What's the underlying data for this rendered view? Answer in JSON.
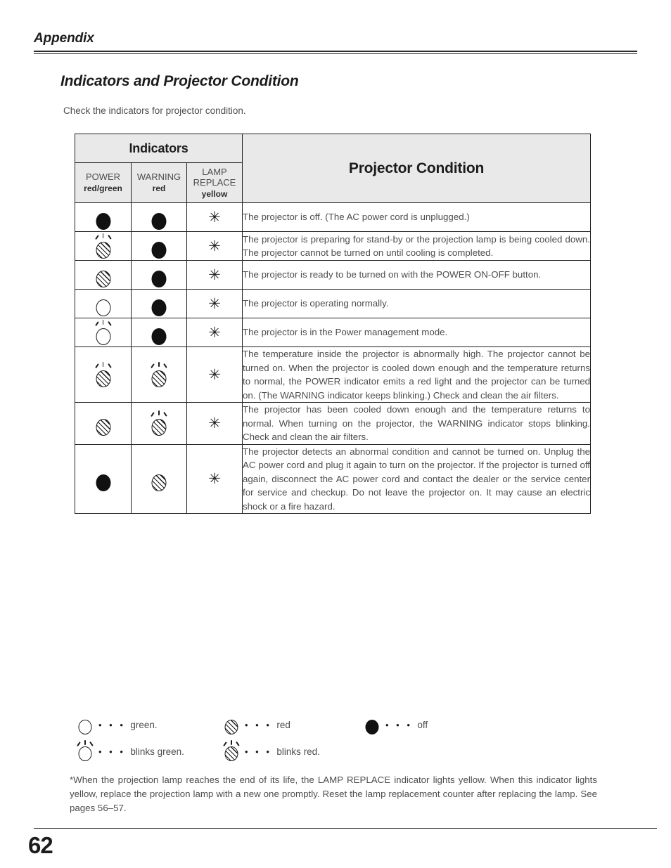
{
  "header": {
    "running_head": "Appendix"
  },
  "section": {
    "title": "Indicators and Projector Condition",
    "intro": "Check the indicators for projector condition."
  },
  "table": {
    "group_header": "Indicators",
    "condition_header": "Projector Condition",
    "columns": [
      {
        "name": "POWER",
        "color": "red/green"
      },
      {
        "name": "WARNING",
        "color": "red"
      },
      {
        "name": "LAMP\nREPLACE",
        "color": "yellow"
      }
    ],
    "column_names": {
      "power": "POWER",
      "power_color": "red/green",
      "warning": "WARNING",
      "warning_color": "red",
      "lamp_replace_line1": "LAMP",
      "lamp_replace_line2": "REPLACE",
      "lamp_replace_color": "yellow"
    },
    "rows": [
      {
        "power": "off",
        "warning": "off",
        "lamp_replace": "star",
        "description": "The projector is off. (The AC power cord is unplugged.)"
      },
      {
        "power": "blinks-red",
        "warning": "off",
        "lamp_replace": "star",
        "description": "The projector is preparing for stand-by or the projection lamp is being cooled down. The projector cannot be turned on until cooling is completed."
      },
      {
        "power": "red",
        "warning": "off",
        "lamp_replace": "star",
        "description": "The projector is ready to be turned on with the POWER ON-OFF button."
      },
      {
        "power": "green",
        "warning": "off",
        "lamp_replace": "star",
        "description": "The projector is operating normally."
      },
      {
        "power": "blinks-green",
        "warning": "off",
        "lamp_replace": "star",
        "description": "The projector is in the Power management mode."
      },
      {
        "power": "blinks-red",
        "warning": "blinks-red",
        "lamp_replace": "star",
        "description": "The temperature inside the projector is abnormally high. The projector cannot be turned on. When  the projector is cooled down enough and the temperature returns to normal, the POWER indicator emits a red light and the projector can be turned on.  (The WARNING indicator keeps blinking.) Check and clean the air filters."
      },
      {
        "power": "red",
        "warning": "blinks-red",
        "lamp_replace": "star",
        "description": "The projector has been cooled down enough and the temperature returns to normal.  When turning on the projector, the WARNING indicator stops blinking. Check and clean the air filters."
      },
      {
        "power": "off",
        "warning": "red",
        "lamp_replace": "star",
        "description": "The projector detects an abnormal condition and cannot be turned on. Unplug the AC power cord and plug it again to turn on the projector. If the projector is turned off again, disconnect the AC power cord and contact the dealer or the service center for service and checkup. Do not leave the projector on. It may cause an electric shock or a fire hazard."
      }
    ]
  },
  "legend": {
    "dots": "• • •",
    "items": [
      {
        "glyph": "green",
        "label": "green."
      },
      {
        "glyph": "red",
        "label": "red"
      },
      {
        "glyph": "off",
        "label": "off"
      },
      {
        "glyph": "blinks-green",
        "label": "blinks green."
      },
      {
        "glyph": "blinks-red",
        "label": "blinks red."
      }
    ]
  },
  "footnote": "*When the projection lamp reaches the end of its life, the LAMP REPLACE indicator lights yellow. When this indicator lights yellow, replace the projection lamp with a new one promptly. Reset the lamp replacement counter after replacing the lamp. See pages 56–57.",
  "folio": {
    "page_number": "62"
  },
  "star_glyph": "✳"
}
